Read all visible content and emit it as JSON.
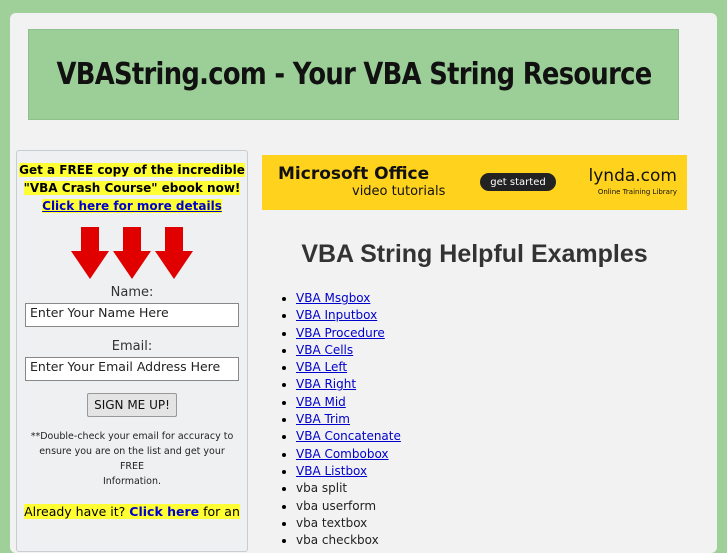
{
  "header": {
    "title": "VBAString.com - Your VBA String Resource"
  },
  "sidebar": {
    "promo_line1": "Get a FREE copy of the incredible",
    "promo_line2": "\"VBA Crash Course\" ebook now!",
    "promo_link": "Click here for more details",
    "name_label": "Name:",
    "name_value": "Enter Your Name Here",
    "email_label": "Email:",
    "email_value": "Enter Your Email Address Here",
    "signup_label": "SIGN ME UP!",
    "note_line1": "**Double-check your email for accuracy to",
    "note_line2": "ensure you are on the list and get your FREE",
    "note_line3": "Information.",
    "already_prefix": "Already have it?",
    "already_link": "Click here",
    "already_suffix": "for an"
  },
  "ad": {
    "title": "Microsoft Office",
    "subtitle": "video tutorials",
    "button": "get started",
    "brand": "lynda.com",
    "tagline": "Online Training Library"
  },
  "main": {
    "heading": "VBA String Helpful Examples",
    "links": [
      "VBA Msgbox",
      "VBA Inputbox",
      "VBA Procedure",
      "VBA Cells",
      "VBA Left",
      "VBA Right",
      "VBA Mid",
      "VBA Trim",
      "VBA Concatenate",
      "VBA Combobox",
      "VBA Listbox"
    ],
    "plain": [
      "vba split",
      "vba userform",
      "vba textbox",
      "vba checkbox"
    ]
  },
  "colors": {
    "background": "#a0d09a",
    "banner": "#9ccf98",
    "ad": "#ffd21e",
    "highlight": "#ffff33",
    "arrow": "#e00000"
  }
}
